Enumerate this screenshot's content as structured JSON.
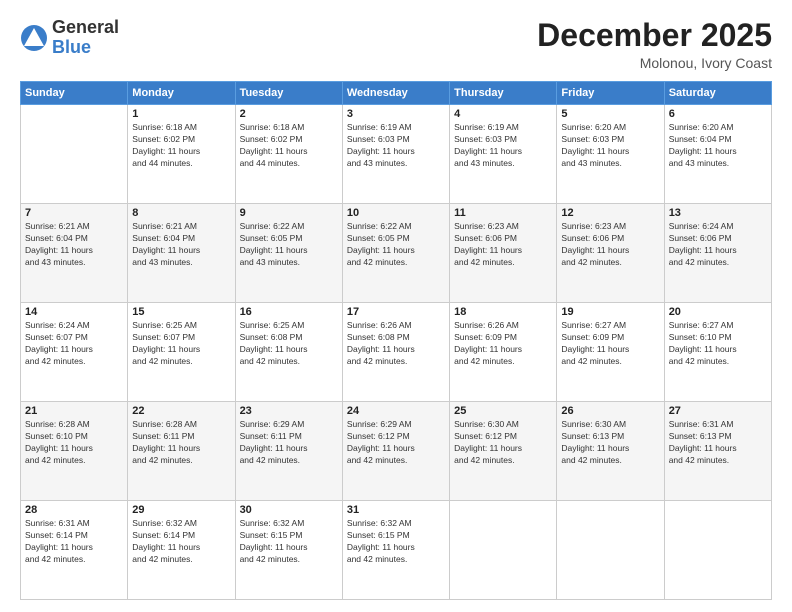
{
  "header": {
    "logo_general": "General",
    "logo_blue": "Blue",
    "month_title": "December 2025",
    "location": "Molonou, Ivory Coast"
  },
  "days_of_week": [
    "Sunday",
    "Monday",
    "Tuesday",
    "Wednesday",
    "Thursday",
    "Friday",
    "Saturday"
  ],
  "weeks": [
    [
      {
        "day": "",
        "info": ""
      },
      {
        "day": "1",
        "info": "Sunrise: 6:18 AM\nSunset: 6:02 PM\nDaylight: 11 hours\nand 44 minutes."
      },
      {
        "day": "2",
        "info": "Sunrise: 6:18 AM\nSunset: 6:02 PM\nDaylight: 11 hours\nand 44 minutes."
      },
      {
        "day": "3",
        "info": "Sunrise: 6:19 AM\nSunset: 6:03 PM\nDaylight: 11 hours\nand 43 minutes."
      },
      {
        "day": "4",
        "info": "Sunrise: 6:19 AM\nSunset: 6:03 PM\nDaylight: 11 hours\nand 43 minutes."
      },
      {
        "day": "5",
        "info": "Sunrise: 6:20 AM\nSunset: 6:03 PM\nDaylight: 11 hours\nand 43 minutes."
      },
      {
        "day": "6",
        "info": "Sunrise: 6:20 AM\nSunset: 6:04 PM\nDaylight: 11 hours\nand 43 minutes."
      }
    ],
    [
      {
        "day": "7",
        "info": "Sunrise: 6:21 AM\nSunset: 6:04 PM\nDaylight: 11 hours\nand 43 minutes."
      },
      {
        "day": "8",
        "info": "Sunrise: 6:21 AM\nSunset: 6:04 PM\nDaylight: 11 hours\nand 43 minutes."
      },
      {
        "day": "9",
        "info": "Sunrise: 6:22 AM\nSunset: 6:05 PM\nDaylight: 11 hours\nand 43 minutes."
      },
      {
        "day": "10",
        "info": "Sunrise: 6:22 AM\nSunset: 6:05 PM\nDaylight: 11 hours\nand 42 minutes."
      },
      {
        "day": "11",
        "info": "Sunrise: 6:23 AM\nSunset: 6:06 PM\nDaylight: 11 hours\nand 42 minutes."
      },
      {
        "day": "12",
        "info": "Sunrise: 6:23 AM\nSunset: 6:06 PM\nDaylight: 11 hours\nand 42 minutes."
      },
      {
        "day": "13",
        "info": "Sunrise: 6:24 AM\nSunset: 6:06 PM\nDaylight: 11 hours\nand 42 minutes."
      }
    ],
    [
      {
        "day": "14",
        "info": "Sunrise: 6:24 AM\nSunset: 6:07 PM\nDaylight: 11 hours\nand 42 minutes."
      },
      {
        "day": "15",
        "info": "Sunrise: 6:25 AM\nSunset: 6:07 PM\nDaylight: 11 hours\nand 42 minutes."
      },
      {
        "day": "16",
        "info": "Sunrise: 6:25 AM\nSunset: 6:08 PM\nDaylight: 11 hours\nand 42 minutes."
      },
      {
        "day": "17",
        "info": "Sunrise: 6:26 AM\nSunset: 6:08 PM\nDaylight: 11 hours\nand 42 minutes."
      },
      {
        "day": "18",
        "info": "Sunrise: 6:26 AM\nSunset: 6:09 PM\nDaylight: 11 hours\nand 42 minutes."
      },
      {
        "day": "19",
        "info": "Sunrise: 6:27 AM\nSunset: 6:09 PM\nDaylight: 11 hours\nand 42 minutes."
      },
      {
        "day": "20",
        "info": "Sunrise: 6:27 AM\nSunset: 6:10 PM\nDaylight: 11 hours\nand 42 minutes."
      }
    ],
    [
      {
        "day": "21",
        "info": "Sunrise: 6:28 AM\nSunset: 6:10 PM\nDaylight: 11 hours\nand 42 minutes."
      },
      {
        "day": "22",
        "info": "Sunrise: 6:28 AM\nSunset: 6:11 PM\nDaylight: 11 hours\nand 42 minutes."
      },
      {
        "day": "23",
        "info": "Sunrise: 6:29 AM\nSunset: 6:11 PM\nDaylight: 11 hours\nand 42 minutes."
      },
      {
        "day": "24",
        "info": "Sunrise: 6:29 AM\nSunset: 6:12 PM\nDaylight: 11 hours\nand 42 minutes."
      },
      {
        "day": "25",
        "info": "Sunrise: 6:30 AM\nSunset: 6:12 PM\nDaylight: 11 hours\nand 42 minutes."
      },
      {
        "day": "26",
        "info": "Sunrise: 6:30 AM\nSunset: 6:13 PM\nDaylight: 11 hours\nand 42 minutes."
      },
      {
        "day": "27",
        "info": "Sunrise: 6:31 AM\nSunset: 6:13 PM\nDaylight: 11 hours\nand 42 minutes."
      }
    ],
    [
      {
        "day": "28",
        "info": "Sunrise: 6:31 AM\nSunset: 6:14 PM\nDaylight: 11 hours\nand 42 minutes."
      },
      {
        "day": "29",
        "info": "Sunrise: 6:32 AM\nSunset: 6:14 PM\nDaylight: 11 hours\nand 42 minutes."
      },
      {
        "day": "30",
        "info": "Sunrise: 6:32 AM\nSunset: 6:15 PM\nDaylight: 11 hours\nand 42 minutes."
      },
      {
        "day": "31",
        "info": "Sunrise: 6:32 AM\nSunset: 6:15 PM\nDaylight: 11 hours\nand 42 minutes."
      },
      {
        "day": "",
        "info": ""
      },
      {
        "day": "",
        "info": ""
      },
      {
        "day": "",
        "info": ""
      }
    ]
  ]
}
